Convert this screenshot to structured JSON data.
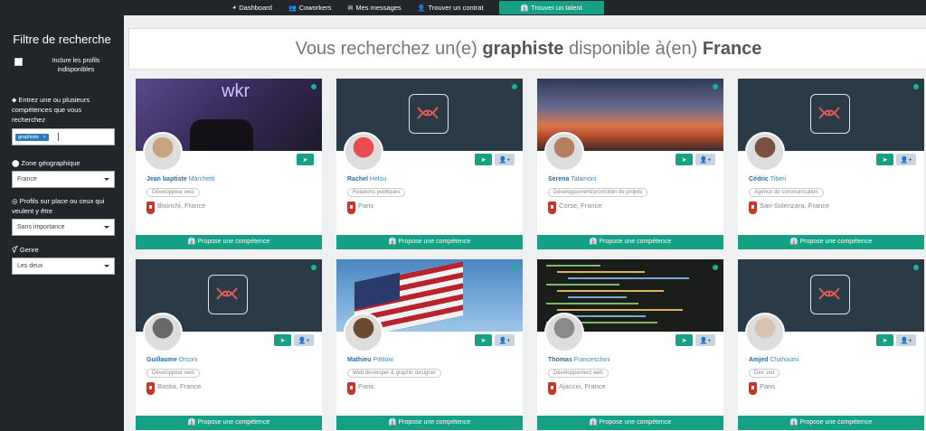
{
  "nav": {
    "items": [
      {
        "label": "Dashboard",
        "icon": "dashboard-icon",
        "glyph": "◕"
      },
      {
        "label": "Coworkers",
        "icon": "users-icon",
        "glyph": "👥"
      },
      {
        "label": "Mes messages",
        "icon": "envelope-icon",
        "glyph": "✉"
      },
      {
        "label": "Trouver un contrat",
        "icon": "user-icon",
        "glyph": "👤"
      },
      {
        "label": "Trouver un talent",
        "icon": "tie-icon",
        "glyph": "👔",
        "active": true
      }
    ]
  },
  "sidebar": {
    "title": "Filtre de recherche",
    "include_label": "Inclure les profils indisponibles",
    "skills_label": "Entrez une ou plusieurs compétences que vous recherchez",
    "skill_tag": "graphiste",
    "tag_remove": "×",
    "zone_label": "Zone géographique",
    "zone_value": "France",
    "profile_label": "Profils sur place ou ceux qui veulent y être",
    "profile_value": "Sans importance",
    "gender_label": "Genre",
    "gender_value": "Les deux"
  },
  "headline": {
    "pre": "Vous recherchez un(e) ",
    "skill": "graphiste",
    "mid": " disponible à(en) ",
    "place": "France"
  },
  "propose_label": "Propose une compétence",
  "cards": [
    {
      "first": "Jean baptiste",
      "last": "Marchetti",
      "job": "Développeur web",
      "loc": "Bisinchi, France",
      "cover": "photo-purple",
      "avatar": "#c9a27e",
      "add": false
    },
    {
      "first": "Rachel",
      "last": "Helou",
      "job": "Relations publiques",
      "loc": "Paris",
      "cover": "logo",
      "avatar": "#e94b4f",
      "add": true
    },
    {
      "first": "Serena",
      "last": "Talamoni",
      "job": "Développement/promotion de projets",
      "loc": "Corse, France",
      "cover": "sunset",
      "avatar": "#b57e5c",
      "add": true
    },
    {
      "first": "Cédric",
      "last": "Tiberi",
      "job": "Agence de communication",
      "loc": "Sari-Solenzara, France",
      "cover": "logo",
      "avatar": "#7a5040",
      "add": true
    },
    {
      "first": "Guillaume",
      "last": "Orsoni",
      "job": "Développeur web",
      "loc": "Bastia, France",
      "cover": "logo",
      "avatar": "#6a6a6a",
      "add": true
    },
    {
      "first": "Mathieu",
      "last": "Pittiloni",
      "job": "Web developer & graphic designer",
      "loc": "Paris",
      "cover": "flag",
      "avatar": "#6b4a32",
      "add": true
    },
    {
      "first": "Thomas",
      "last": "Franceschini",
      "job": "Développement web",
      "loc": "Ajaccio, France",
      "cover": "code",
      "avatar": "#8a8a8a",
      "add": true
    },
    {
      "first": "Amjed",
      "last": "Chahoumi",
      "job": "Dev .net",
      "loc": "Paris",
      "cover": "logo",
      "avatar": "#d8c4b0",
      "add": true
    }
  ]
}
